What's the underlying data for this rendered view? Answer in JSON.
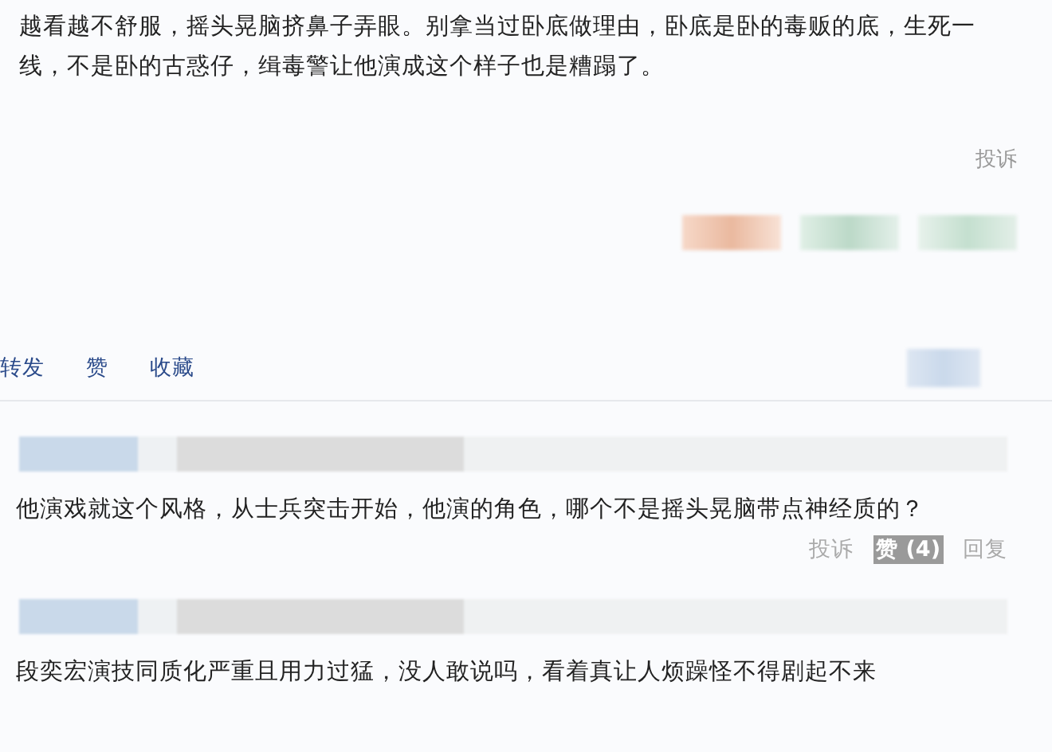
{
  "post": {
    "text": "越看越不舒服，摇头晃脑挤鼻子弄眼。别拿当过卧底做理由，卧底是卧的毒贩的底，生死一线，不是卧的古惑仔，缉毒警让他演成这个样子也是糟蹋了。",
    "report": "投诉",
    "actions": [
      "转发",
      "赞",
      "收藏"
    ]
  },
  "comments": [
    {
      "text": "他演戏就这个风格，从士兵突击开始，他演的角色，哪个不是摇头晃脑带点神经质的？",
      "actions": [
        {
          "label": "投诉",
          "highlighted": false
        },
        {
          "label": "赞 (4)",
          "highlighted": true
        },
        {
          "label": "回复",
          "highlighted": false
        }
      ]
    },
    {
      "text": "段奕宏演技同质化严重且用力过猛，没人敢说吗，看着真让人烦躁怪不得剧起不来"
    }
  ]
}
